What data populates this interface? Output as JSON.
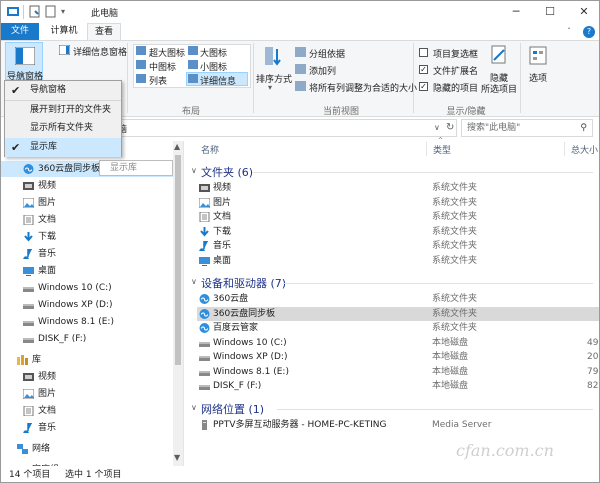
{
  "window": {
    "title": "此电脑",
    "minimize": "─",
    "maximize": "☐",
    "close": "✕",
    "help": "?",
    "collapse_ribbon": "ˆ"
  },
  "tabs": [
    "文件",
    "计算机",
    "查看"
  ],
  "ribbon": {
    "nav_pane_label": "导航窗格",
    "details_pane_label": "详细信息窗格",
    "layout": {
      "xlarge": "超大图标",
      "large": "大图标",
      "medium": "中图标",
      "small": "小图标",
      "list": "列表",
      "details": "详细信息",
      "group_label": "布局"
    },
    "sort_label": "排序方式",
    "current_view": {
      "group_by": "分组依据",
      "add_column": "添加列",
      "fit_columns": "将所有列调整为合适的大小",
      "group_label": "当前视图"
    },
    "show_hide": {
      "item_checkboxes": "项目复选框",
      "file_extensions": "文件扩展名",
      "hidden_items": "隐藏的项目",
      "hide_selected_1": "隐藏",
      "hide_selected_2": "所选项目",
      "options": "选项",
      "group_label": "显示/隐藏"
    }
  },
  "dropdown": {
    "items": [
      {
        "label": "导航窗格",
        "checked": true
      },
      {
        "label": "展开到打开的文件夹",
        "checked": false
      },
      {
        "label": "显示所有文件夹",
        "checked": false
      },
      {
        "label": "显示库",
        "checked": true
      }
    ]
  },
  "address": {
    "path_fragment": "脑",
    "search_placeholder": "搜索\"此电脑\""
  },
  "tooltip_fragment": "显示库",
  "nav": {
    "items": [
      {
        "label": "360云盘同步板",
        "indent": 1,
        "selected": true
      },
      {
        "label": "视频",
        "indent": 1
      },
      {
        "label": "图片",
        "indent": 1
      },
      {
        "label": "文档",
        "indent": 1
      },
      {
        "label": "下载",
        "indent": 1
      },
      {
        "label": "音乐",
        "indent": 1
      },
      {
        "label": "桌面",
        "indent": 1
      },
      {
        "label": "Windows 10 (C:)",
        "indent": 1
      },
      {
        "label": "Windows XP (D:)",
        "indent": 1
      },
      {
        "label": "Windows 8.1 (E:)",
        "indent": 1
      },
      {
        "label": "DISK_F (F:)",
        "indent": 1
      },
      {
        "label": "库",
        "indent": 0
      },
      {
        "label": "视频",
        "indent": 1
      },
      {
        "label": "图片",
        "indent": 1
      },
      {
        "label": "文档",
        "indent": 1
      },
      {
        "label": "音乐",
        "indent": 1
      },
      {
        "label": "网络",
        "indent": 0
      },
      {
        "label": "家庭组",
        "indent": 0
      }
    ]
  },
  "columns": {
    "name": "名称",
    "type": "类型",
    "size": "总大小"
  },
  "groups": [
    {
      "title": "文件夹 (6)",
      "rows": [
        {
          "name": "视频",
          "type": "系统文件夹",
          "size": ""
        },
        {
          "name": "图片",
          "type": "系统文件夹",
          "size": ""
        },
        {
          "name": "文档",
          "type": "系统文件夹",
          "size": ""
        },
        {
          "name": "下载",
          "type": "系统文件夹",
          "size": ""
        },
        {
          "name": "音乐",
          "type": "系统文件夹",
          "size": ""
        },
        {
          "name": "桌面",
          "type": "系统文件夹",
          "size": ""
        }
      ]
    },
    {
      "title": "设备和驱动器 (7)",
      "rows": [
        {
          "name": "360云盘",
          "type": "系统文件夹",
          "size": ""
        },
        {
          "name": "360云盘同步板",
          "type": "系统文件夹",
          "size": "",
          "selected": true
        },
        {
          "name": "百度云管家",
          "type": "系统文件夹",
          "size": ""
        },
        {
          "name": "Windows 10 (C:)",
          "type": "本地磁盘",
          "size": "49."
        },
        {
          "name": "Windows XP (D:)",
          "type": "本地磁盘",
          "size": "20."
        },
        {
          "name": "Windows 8.1 (E:)",
          "type": "本地磁盘",
          "size": "79."
        },
        {
          "name": "DISK_F (F:)",
          "type": "本地磁盘",
          "size": "82."
        }
      ]
    },
    {
      "title": "网络位置 (1)",
      "rows": [
        {
          "name": "PPTV多屏互动服务器 - HOME-PC-KETING",
          "type": "Media Server",
          "size": ""
        }
      ]
    }
  ],
  "status": {
    "count": "14 个项目",
    "selected": "选中 1 个项目"
  },
  "watermark": "cfan.com.cn",
  "colors": {
    "accent": "#1979ca",
    "selection": "#cce8ff",
    "group_header": "#1e3287"
  }
}
